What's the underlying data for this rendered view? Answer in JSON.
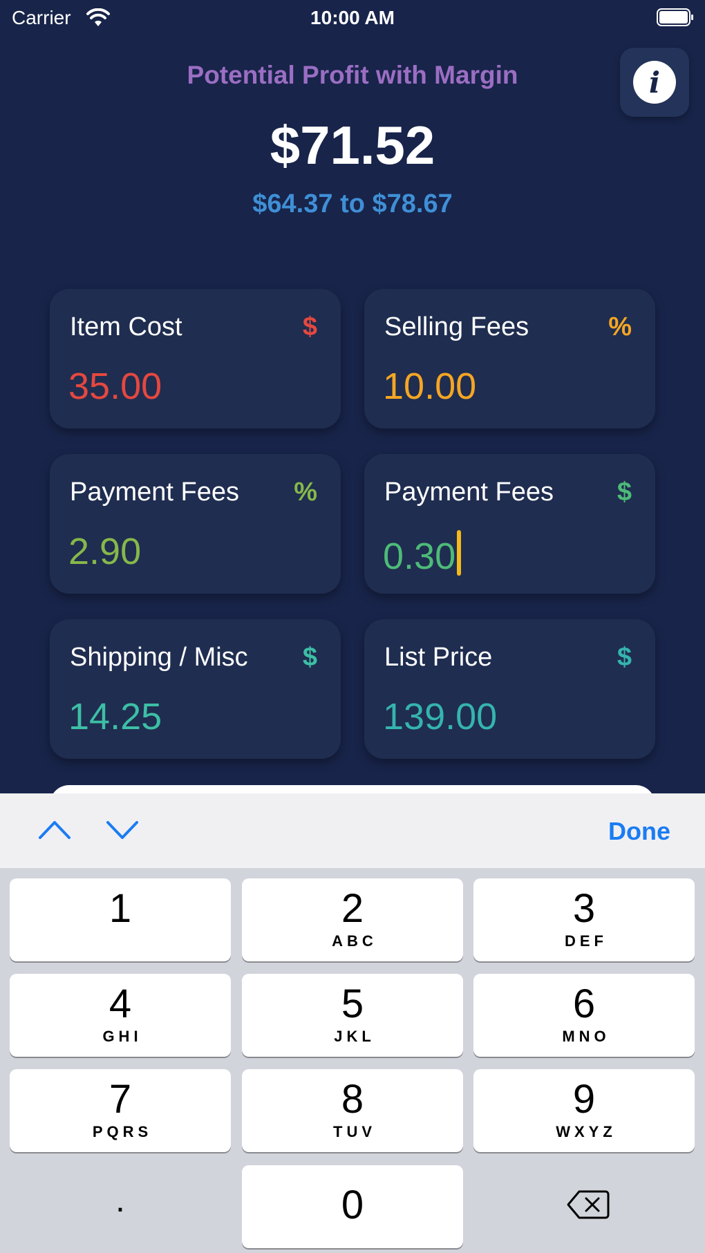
{
  "status": {
    "carrier": "Carrier",
    "time": "10:00 AM"
  },
  "header": {
    "subtitle": "Potential Profit with Margin",
    "profit": "$71.52",
    "range": "$64.37 to $78.67",
    "info_icon": "info-icon"
  },
  "cards": [
    {
      "label": "Item Cost",
      "unit": "$",
      "value": "35.00",
      "color": "#e5483f"
    },
    {
      "label": "Selling Fees",
      "unit": "%",
      "value": "10.00",
      "color": "#f5a623"
    },
    {
      "label": "Payment Fees",
      "unit": "%",
      "value": "2.90",
      "color": "#86b84a"
    },
    {
      "label": "Payment Fees",
      "unit": "$",
      "value": "0.30",
      "color": "#4dbb78"
    },
    {
      "label": "Shipping / Misc",
      "unit": "$",
      "value": "14.25",
      "color": "#3dbfa5"
    },
    {
      "label": "List Price",
      "unit": "$",
      "value": "139.00",
      "color": "#35b4ad"
    }
  ],
  "accessory": {
    "done_label": "Done"
  },
  "keys": [
    {
      "num": "1",
      "letters": ""
    },
    {
      "num": "2",
      "letters": "ABC"
    },
    {
      "num": "3",
      "letters": "DEF"
    },
    {
      "num": "4",
      "letters": "GHI"
    },
    {
      "num": "5",
      "letters": "JKL"
    },
    {
      "num": "6",
      "letters": "MNO"
    },
    {
      "num": "7",
      "letters": "PQRS"
    },
    {
      "num": "8",
      "letters": "TUV"
    },
    {
      "num": "9",
      "letters": "WXYZ"
    },
    {
      "num": "0",
      "letters": ""
    }
  ],
  "decimal_key": "."
}
